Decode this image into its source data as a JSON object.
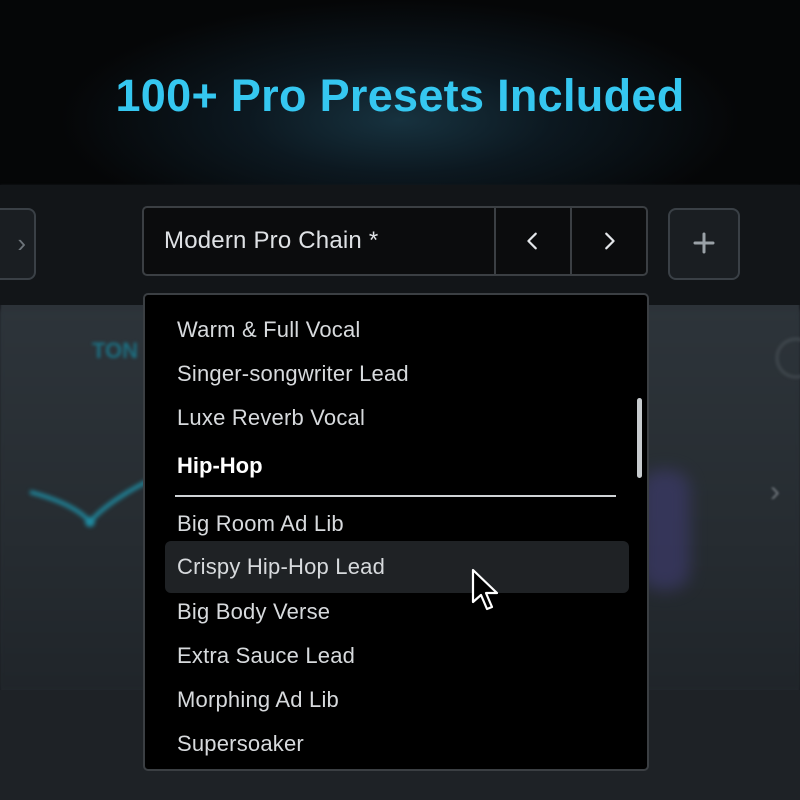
{
  "promo": {
    "title": "100+ Pro Presets Included"
  },
  "selector": {
    "preset_name": "Modern Pro Chain *",
    "prev_icon": "chevron-left-icon",
    "next_icon": "chevron-right-icon"
  },
  "background": {
    "add_icon": "plus-icon"
  },
  "dropdown": {
    "items_top": [
      "Warm & Full Vocal",
      "Singer-songwriter Lead",
      "Luxe Reverb Vocal"
    ],
    "section_header": "Hip-Hop",
    "items_hiphop": [
      "Big Room Ad Lib",
      "Crispy Hip-Hop Lead",
      "Big Body Verse",
      "Extra Sauce Lead",
      "Morphing Ad Lib",
      "Supersoaker"
    ],
    "hovered_item": "Crispy Hip-Hop Lead"
  },
  "colors": {
    "accent": "#35c7f0",
    "hover_bg": "#1f2225",
    "border": "#3b3f43"
  }
}
